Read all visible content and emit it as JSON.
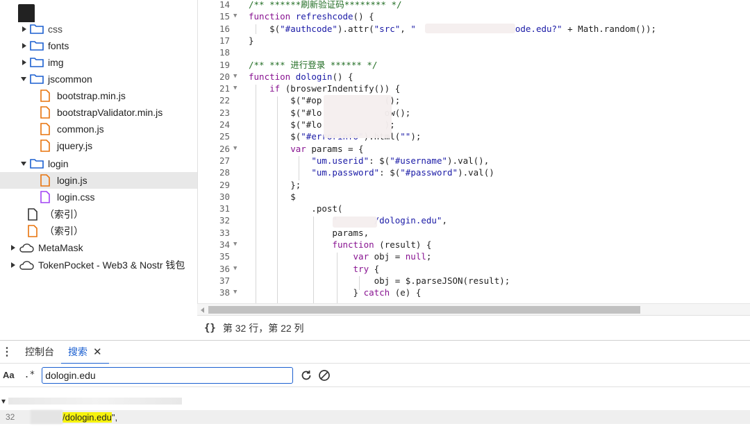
{
  "tree": {
    "items": [
      {
        "label": "css",
        "type": "folder",
        "expanded": false
      },
      {
        "label": "fonts",
        "type": "folder",
        "expanded": false
      },
      {
        "label": "img",
        "type": "folder",
        "expanded": false
      },
      {
        "label": "jscommon",
        "type": "folder",
        "expanded": true
      },
      {
        "label": "bootstrap.min.js",
        "type": "file-js"
      },
      {
        "label": "bootstrapValidator.min.js",
        "type": "file-js"
      },
      {
        "label": "common.js",
        "type": "file-js"
      },
      {
        "label": "jquery.js",
        "type": "file-js"
      },
      {
        "label": "login",
        "type": "folder",
        "expanded": true
      },
      {
        "label": "login.js",
        "type": "file-js",
        "selected": true
      },
      {
        "label": "login.css",
        "type": "file-css"
      },
      {
        "label": "（索引）",
        "type": "file-plain"
      },
      {
        "label": "（索引）",
        "type": "file-js"
      },
      {
        "label": "MetaMask",
        "type": "extension"
      },
      {
        "label": "TokenPocket - Web3 & Nostr 钱包",
        "type": "extension"
      }
    ]
  },
  "editor": {
    "lines": [
      {
        "n": "14",
        "fold": false,
        "text": "/** ******刷新验证码******** */"
      },
      {
        "n": "15",
        "fold": true,
        "text": "function refreshcode() {"
      },
      {
        "n": "16",
        "fold": false,
        "text": "    $(\"#authcode\").attr(\"src\", \"                   ode.edu?\" + Math.random());"
      },
      {
        "n": "17",
        "fold": false,
        "text": "}"
      },
      {
        "n": "18",
        "fold": false,
        "text": ""
      },
      {
        "n": "19",
        "fold": false,
        "text": "/** *** 进行登录 ****** */"
      },
      {
        "n": "20",
        "fold": true,
        "text": "function dologin() {"
      },
      {
        "n": "21",
        "fold": true,
        "text": "    if (broswerIndentify()) {"
      },
      {
        "n": "22",
        "fold": false,
        "text": "        $(\"#op            ();"
      },
      {
        "n": "23",
        "fold": false,
        "text": "        $(\"#lo            ow();"
      },
      {
        "n": "24",
        "fold": false,
        "text": "        $(\"#lo            );"
      },
      {
        "n": "25",
        "fold": false,
        "text": "        $(\"#errorinfo\").html(\"\");"
      },
      {
        "n": "26",
        "fold": true,
        "text": "        var params = {"
      },
      {
        "n": "27",
        "fold": false,
        "text": "            \"um.userid\": $(\"#username\").val(),"
      },
      {
        "n": "28",
        "fold": false,
        "text": "            \"um.password\": $(\"#password\").val()"
      },
      {
        "n": "29",
        "fold": false,
        "text": "        };"
      },
      {
        "n": "30",
        "fold": false,
        "text": "        $"
      },
      {
        "n": "31",
        "fold": false,
        "text": "            .post("
      },
      {
        "n": "32",
        "fold": false,
        "text": "                \"       /dologin.edu\","
      },
      {
        "n": "33",
        "fold": false,
        "text": "                params,"
      },
      {
        "n": "34",
        "fold": true,
        "text": "                function (result) {"
      },
      {
        "n": "35",
        "fold": false,
        "text": "                    var obj = null;"
      },
      {
        "n": "36",
        "fold": true,
        "text": "                    try {"
      },
      {
        "n": "37",
        "fold": false,
        "text": "                        obj = $.parseJSON(result);"
      },
      {
        "n": "38",
        "fold": true,
        "text": "                    } catch (e) {"
      }
    ]
  },
  "status": {
    "braces": "{}",
    "position": "第 32 行，第 22 列"
  },
  "drawer": {
    "tabs": [
      {
        "label": "控制台",
        "active": false
      },
      {
        "label": "搜索",
        "active": true,
        "close": "✕"
      }
    ],
    "match_case_label": "Aa",
    "regex_label": ".*",
    "query": "dologin.edu",
    "results": {
      "file_label": "▾",
      "line_number": "32",
      "match_prefix": "\"",
      "match_text": "/dologin.edu",
      "match_suffix": "\","
    }
  }
}
